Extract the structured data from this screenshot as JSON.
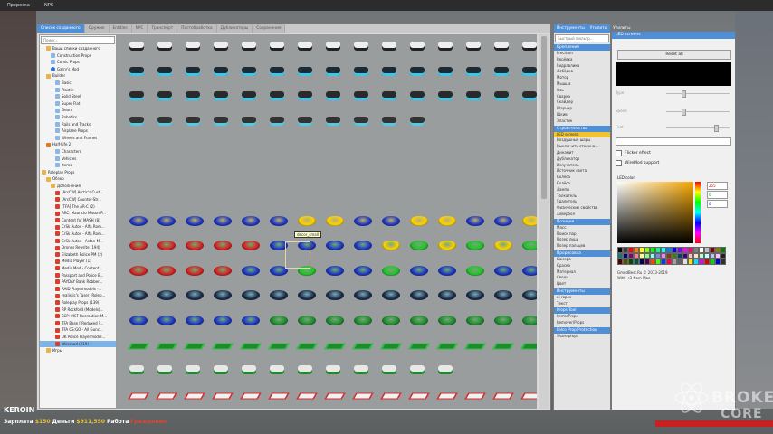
{
  "menubar": {
    "items": [
      "Прорезка",
      "NPC"
    ]
  },
  "spawn": {
    "tabs": [
      {
        "label": "Список созданного",
        "active": true
      },
      {
        "label": "Оружие",
        "active": false
      },
      {
        "label": "Entities",
        "active": false
      },
      {
        "label": "NPC",
        "active": false
      },
      {
        "label": "Транспорт",
        "active": false
      },
      {
        "label": "Постобработка",
        "active": false
      },
      {
        "label": "Дубликаторы",
        "active": false
      },
      {
        "label": "Сохранения",
        "active": false
      }
    ],
    "search_placeholder": "Поиск...",
    "tree": [
      {
        "label": "Ваши списки созданного",
        "icon": "folder",
        "depth": 1
      },
      {
        "label": "Construction Props",
        "icon": "lightblue",
        "depth": 2
      },
      {
        "label": "Comic Props",
        "icon": "lightblue",
        "depth": 2
      },
      {
        "label": "Garry's Mod",
        "icon": "gmod",
        "depth": 2
      },
      {
        "label": "Builder",
        "icon": "folder",
        "depth": 1
      },
      {
        "label": "Basic",
        "icon": "lightblue",
        "depth": 3
      },
      {
        "label": "Plastic",
        "icon": "lightblue",
        "depth": 3
      },
      {
        "label": "Solid Steel",
        "icon": "lightblue",
        "depth": 3
      },
      {
        "label": "Super Flat",
        "icon": "lightblue",
        "depth": 3
      },
      {
        "label": "Gears",
        "icon": "lightblue",
        "depth": 3
      },
      {
        "label": "Robotics",
        "icon": "lightblue",
        "depth": 3
      },
      {
        "label": "Rails and Tracks",
        "icon": "lightblue",
        "depth": 3
      },
      {
        "label": "Airplane Props",
        "icon": "lightblue",
        "depth": 3
      },
      {
        "label": "Wheels and Frames",
        "icon": "lightblue",
        "depth": 3
      },
      {
        "label": "Half-Life 2",
        "icon": "hl",
        "depth": 1
      },
      {
        "label": "Characters",
        "icon": "lightblue",
        "depth": 3
      },
      {
        "label": "Vehicles",
        "icon": "lightblue",
        "depth": 3
      },
      {
        "label": "Items",
        "icon": "lightblue",
        "depth": 3
      },
      {
        "label": "Roleplay Props",
        "icon": "folder",
        "depth": 0
      },
      {
        "label": "Обзор",
        "icon": "folder",
        "depth": 1
      },
      {
        "label": "Дополнения",
        "icon": "folder",
        "depth": 2
      },
      {
        "label": "[ArcCW] Arctic's Cust...",
        "icon": "red",
        "depth": 3
      },
      {
        "label": "[ArcCW] Counter-Str...",
        "icon": "red",
        "depth": 3
      },
      {
        "label": "[TFA] The AR-C (2)",
        "icon": "red",
        "depth": 3
      },
      {
        "label": "ARC: Mauricio Mason P...",
        "icon": "red",
        "depth": 3
      },
      {
        "label": "Content for MASH (8)",
        "icon": "red",
        "depth": 3
      },
      {
        "label": "CrSk Autos - Alfa Rom...",
        "icon": "red",
        "depth": 3
      },
      {
        "label": "CrSk Autos - Alfa Rom...",
        "icon": "red",
        "depth": 3
      },
      {
        "label": "CrSk Autos - Aston M...",
        "icon": "red",
        "depth": 3
      },
      {
        "label": "Drones Rewrite (194)",
        "icon": "red",
        "depth": 3
      },
      {
        "label": "Elizabeth Police PM (2)",
        "icon": "red",
        "depth": 3
      },
      {
        "label": "Media Player (1)",
        "icon": "red",
        "depth": 3
      },
      {
        "label": "Medic Mod - Content ...",
        "icon": "red",
        "depth": 3
      },
      {
        "label": "Passport and Police B...",
        "icon": "red",
        "depth": 3
      },
      {
        "label": "PAYDAY Bank Robber...",
        "icon": "red",
        "depth": 3
      },
      {
        "label": "RAID Playermodels -...",
        "icon": "red",
        "depth": 3
      },
      {
        "label": "realistic's Taser (Rolep...",
        "icon": "red",
        "depth": 3
      },
      {
        "label": "Roleplay Props (139)",
        "icon": "red",
        "depth": 3
      },
      {
        "label": "RP Rockford (Models)...",
        "icon": "red",
        "depth": 3
      },
      {
        "label": "SCP: MCF Recreation M...",
        "icon": "red",
        "depth": 3
      },
      {
        "label": "TFA Base [ Reduxed ]...",
        "icon": "red",
        "depth": 3
      },
      {
        "label": "TFA CS:GO - All Gunc...",
        "icon": "red",
        "depth": 3
      },
      {
        "label": "UK Police Playermodel...",
        "icon": "red",
        "depth": 3
      },
      {
        "label": "Wiremod (219)",
        "icon": "red",
        "depth": 3,
        "selected": true
      },
      {
        "label": "Игры",
        "icon": "folder",
        "depth": 1
      }
    ],
    "tooltip": "decor_small",
    "icon_rows": [
      {
        "kind": "dev-white",
        "count": 15
      },
      {
        "kind": "dev-dark",
        "count": 15
      },
      {
        "kind": "dev-mix",
        "count": 15
      },
      {
        "kind": "dev-mix2",
        "count": 11
      },
      {
        "kind": "btn-white-red",
        "count": 15
      },
      {
        "kind": "btn-red",
        "count": 15
      },
      {
        "kind": "btn-blue",
        "count": 15
      },
      {
        "kind": "btn-mixed",
        "count": 15
      },
      {
        "kind": "btn-rgb",
        "count": 15
      },
      {
        "kind": "btn-greenish",
        "count": 15
      },
      {
        "kind": "btn-dark",
        "count": 15
      },
      {
        "kind": "btn-blue-green",
        "count": 15
      },
      {
        "kind": "plates",
        "count": 15
      },
      {
        "kind": "small",
        "count": 12
      },
      {
        "kind": "tiles",
        "count": 15
      }
    ]
  },
  "tool": {
    "tabs": [
      "Инструменты",
      "Утилиты",
      "Утилиты"
    ],
    "filter_placeholder": "Быстрый фильтр...",
    "sections": [
      {
        "title": "Крепления",
        "items": [
          "Precision",
          "Верёвка",
          "Гидравлика",
          "Лебёдка",
          "Мотор",
          "Мышца",
          "Ось",
          "Сварка",
          "Скайдер",
          "Шарнир",
          "Шкив",
          "Эластик"
        ]
      },
      {
        "title": "Строительство",
        "items": [
          "LED screens",
          "Воздушные шары",
          "Выключить столкно...",
          "Динамит",
          "Дубликатор",
          "Излучатель",
          "Источник света",
          "Колёса",
          "Колёса",
          "Лампы",
          "Толкатель",
          "Удалитель",
          "Физические свойства",
          "Ховербол"
        ]
      },
      {
        "title": "Позиция",
        "items": [
          "Масс.",
          "Поиск пар",
          "Позер лица",
          "Позер пальцев"
        ]
      },
      {
        "title": "Прорисовка",
        "items": [
          "Камера",
          "Краска",
          "Материал",
          "Сведи",
          "Цвет"
        ]
      },
      {
        "title": "Инструменты",
        "items": [
          "ai-ropes",
          "Текст"
        ]
      },
      {
        "title": "Props Tool",
        "items": [
          "PermaProps",
          "Remover/Props"
        ]
      },
      {
        "title": "Falco Prop Protection",
        "items": [
          "Share props"
        ]
      }
    ],
    "selected": "LED screens"
  },
  "led": {
    "title": "LED screens",
    "reset_label": "Reset all",
    "slider_labels": [
      "Type",
      "Speed",
      "Font"
    ],
    "slider_values": [
      0.25,
      0.25,
      0.8
    ],
    "flicker_label": "Flicker effect",
    "wire_label": "WireMod support",
    "color_label": "LED color",
    "rgb": {
      "r": "255",
      "g": "0",
      "b": "0"
    },
    "credit_lines": [
      "GmodBest.Ru © 2013-2019",
      "With <3 from Mac"
    ],
    "palette": [
      "#000000",
      "#404040",
      "#ff0000",
      "#ff8000",
      "#ffff00",
      "#80ff00",
      "#00ff00",
      "#00ff80",
      "#00ffff",
      "#0080ff",
      "#0000ff",
      "#8000ff",
      "#ff00ff",
      "#ff0080",
      "#808080",
      "#ffffff",
      "#c0c0c0",
      "#800000",
      "#808000",
      "#008000",
      "#008080",
      "#000080",
      "#800080",
      "#ff8080",
      "#ffff80",
      "#80ff80",
      "#80ffff",
      "#8080ff",
      "#ff80ff",
      "#804000",
      "#408000",
      "#004080",
      "#400080",
      "#ffc0c0",
      "#ffe0c0",
      "#c0ffc0",
      "#c0ffff",
      "#c0c0ff",
      "#ffc0ff",
      "#202020",
      "#500000",
      "#505000",
      "#005000",
      "#005050",
      "#000050",
      "#500050",
      "#ff4000",
      "#40ff00",
      "#0040ff",
      "#ff0040",
      "#a0a0a0",
      "#606060",
      "#e0e0e0",
      "#ffe000",
      "#00e0ff",
      "#e000ff",
      "#e00000",
      "#00e000",
      "#0000e0",
      "#303030"
    ]
  },
  "hud": {
    "name": "KEROIN",
    "salary_label": "Зарплата",
    "salary": "$150",
    "money_label": "Деньги",
    "money": "$911,550",
    "job_label": "Работа",
    "job": "Гражданин"
  },
  "watermark": {
    "line1": "BROKEN",
    "line2": "CORE"
  }
}
